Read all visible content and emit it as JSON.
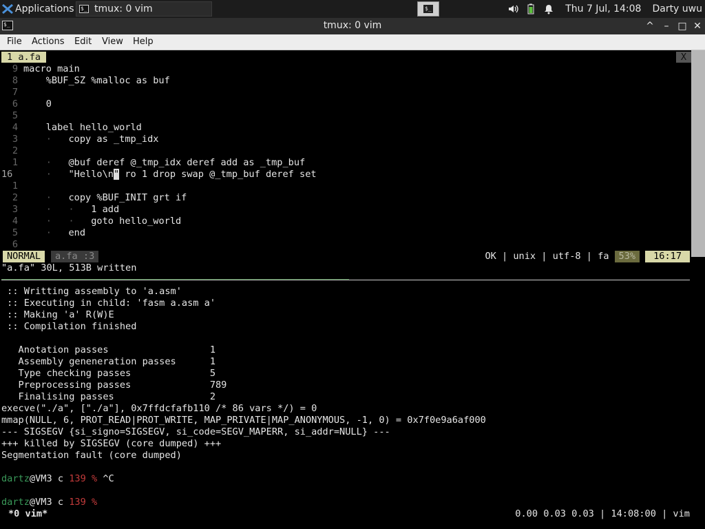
{
  "panel": {
    "apps_label": "Applications",
    "task_label": "tmux: 0 vim",
    "clock": "Thu  7 Jul, 14:08",
    "user": "Darty uwu"
  },
  "window": {
    "title": "tmux: 0 vim",
    "minimize": "^",
    "restore": "–",
    "maximize": "□",
    "close": "✕"
  },
  "menu": [
    "File",
    "Actions",
    "Edit",
    "View",
    "Help"
  ],
  "vim": {
    "tab_label": "1 a.fa",
    "tab_close": "X",
    "lines": [
      {
        "n": "9",
        "text": "macro main"
      },
      {
        "n": "8",
        "text": "    %BUF_SZ %malloc as buf"
      },
      {
        "n": "7",
        "text": ""
      },
      {
        "n": "6",
        "text": "    0"
      },
      {
        "n": "5",
        "text": ""
      },
      {
        "n": "4",
        "text": "    label hello_world"
      },
      {
        "n": "3",
        "text": "    ·   copy as _tmp_idx"
      },
      {
        "n": "2",
        "text": ""
      },
      {
        "n": "1",
        "text": "    ·   @buf deref @_tmp_idx deref add as _tmp_buf"
      },
      {
        "n": "16",
        "text": "    ·   \"Hello\\n\" ro 1 drop swap @_tmp_buf deref set",
        "current": true
      },
      {
        "n": "1",
        "text": ""
      },
      {
        "n": "2",
        "text": "    ·   copy %BUF_INIT grt if"
      },
      {
        "n": "3",
        "text": "    ·   ·   1 add"
      },
      {
        "n": "4",
        "text": "    ·   ·   goto hello_world"
      },
      {
        "n": "5",
        "text": "    ·   end"
      },
      {
        "n": "6",
        "text": ""
      }
    ],
    "status": {
      "mode": "NORMAL",
      "file": "a.fa  :3",
      "right": "OK | unix | utf-8 | fa",
      "percent": "53%",
      "position": "16:17"
    },
    "message": "\"a.fa\" 30L, 513B written"
  },
  "output": {
    "lines": [
      " :: Writting assembly to 'a.asm'",
      " :: Executing in child: 'fasm a.asm a'",
      " :: Making 'a' R(W)E",
      " :: Compilation finished",
      "",
      "   Anotation passes                  1",
      "   Assembly geneneration passes      1",
      "   Type checking passes              5",
      "   Preprocessing passes              789",
      "   Finalising passes                 2",
      "execve(\"./a\", [\"./a\"], 0x7ffdcfafb110 /* 86 vars */) = 0",
      "mmap(NULL, 6, PROT_READ|PROT_WRITE, MAP_PRIVATE|MAP_ANONYMOUS, -1, 0) = 0x7f0e9a6af000",
      "--- SIGSEGV {si_signo=SIGSEGV, si_code=SEGV_MAPERR, si_addr=NULL} ---",
      "+++ killed by SIGSEGV (core dumped) +++",
      "Segmentation fault (core dumped)",
      ""
    ],
    "prompts": [
      {
        "user": "dartz",
        "host": "@VM3 c",
        "code": "139",
        "sym": "%",
        "cmd": " ^C"
      },
      {
        "user": "dartz",
        "host": "@VM3 c",
        "code": "139",
        "sym": "%",
        "cmd": ""
      }
    ]
  },
  "tmux": {
    "window": "*0 vim*",
    "right": "0.00 0.03 0.03 | 14:08:00 | vim"
  }
}
